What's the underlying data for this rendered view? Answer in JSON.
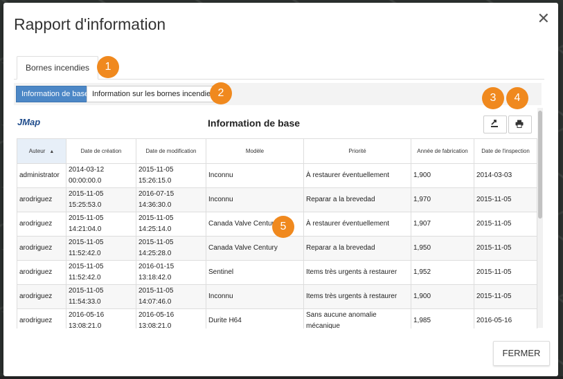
{
  "dialog": {
    "title": "Rapport d'information",
    "close_glyph": "✕",
    "close_label": "close-icon"
  },
  "tabs": [
    {
      "label": "Bornes incendies"
    }
  ],
  "subtabs": [
    {
      "label": "Information de base",
      "active": true
    },
    {
      "label": "Information sur les bornes incendies",
      "active": false
    }
  ],
  "callouts": [
    "1",
    "2",
    "3",
    "4",
    "5"
  ],
  "report": {
    "logo": "JMap",
    "title": "Information de base",
    "export_icon": "export-icon",
    "print_icon": "print-icon",
    "columns": [
      "Auteur",
      "Date de création",
      "Date de modification",
      "Modèle",
      "Priorité",
      "Année de fabrication",
      "Date de l'inspection"
    ],
    "rows": [
      [
        "administrator",
        "2014-03-12 00:00:00.0",
        "2015-11-05 15:26:15.0",
        "Inconnu",
        "À restaurer éventuellement",
        "1,900",
        "2014-03-03"
      ],
      [
        "arodriguez",
        "2015-11-05 15:25:53.0",
        "2016-07-15 14:36:30.0",
        "Inconnu",
        "Reparar a la brevedad",
        "1,970",
        "2015-11-05"
      ],
      [
        "arodriguez",
        "2015-11-05 14:21:04.0",
        "2015-11-05 14:25:14.0",
        "Canada Valve Century",
        "À restaurer éventuellement",
        "1,907",
        "2015-11-05"
      ],
      [
        "arodriguez",
        "2015-11-05 11:52:42.0",
        "2015-11-05 14:25:28.0",
        "Canada Valve Century",
        "Reparar a la brevedad",
        "1,950",
        "2015-11-05"
      ],
      [
        "arodriguez",
        "2015-11-05 11:52:42.0",
        "2016-01-15 13:18:42.0",
        "Sentinel",
        "Items très urgents à restaurer",
        "1,952",
        "2015-11-05"
      ],
      [
        "arodriguez",
        "2015-11-05 11:54:33.0",
        "2015-11-05 14:07:46.0",
        "Inconnu",
        "Items très urgents à restaurer",
        "1,900",
        "2015-11-05"
      ],
      [
        "arodriguez",
        "2016-05-16 13:08:21.0",
        "2016-05-16 13:08:21.0",
        "Durite H64",
        "Sans aucune anomalie mécanique",
        "1,985",
        "2016-05-16"
      ]
    ],
    "sort_column": "Auteur",
    "sort_glyph": "▲"
  },
  "footer": {
    "close_button": "FERMER"
  },
  "colors": {
    "accent": "#4c87c6",
    "callout": "#f0891e"
  }
}
